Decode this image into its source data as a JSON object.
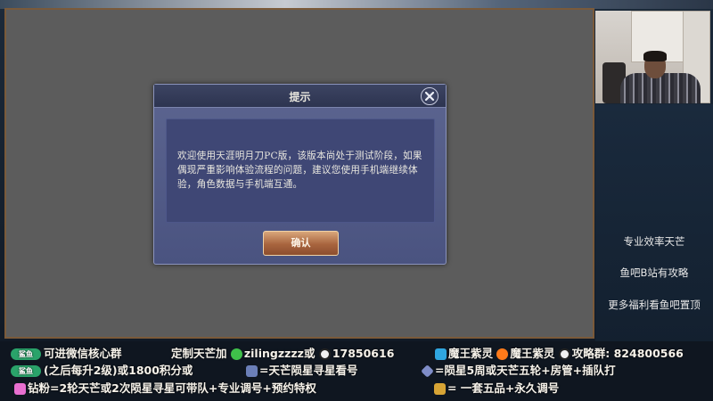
{
  "modal": {
    "title": "提示",
    "message": "欢迎使用天涯明月刀PC版，该版本尚处于测试阶段，如果偶现严重影响体验流程的问题，建议您使用手机端继续体验，角色数据与手机端互通。",
    "confirm_label": "确认"
  },
  "right_panel": {
    "lines": [
      "专业效率天芒",
      "鱼吧B站有攻略",
      "更多福利看鱼吧置顶"
    ]
  },
  "bottom_bar": {
    "row1": {
      "badge": "鲨鱼",
      "text_a": "可进微信核心群",
      "text_b": "定制天芒加",
      "wechat_id": "zilingzzzz或",
      "qq_number": "17850616",
      "bili_name": "魔王紫灵",
      "douyu_name": "魔王紫灵",
      "group_label": "攻略群: 824800566"
    },
    "row2": {
      "badge": "鲨鱼",
      "text_a": "(之后每升2级)或1800积分或",
      "text_b": "=天芒陨星寻星看号",
      "text_c": "=陨星5周或天芒五轮+房管+插队打"
    },
    "row3": {
      "text_a": "钻粉=2轮天芒或2次陨星寻星可带队+专业调号+预约特权",
      "text_b": "= 一套五品+永久调号"
    }
  },
  "colors": {
    "modal_bg": "#4a5380",
    "confirm_button": "#a8643e",
    "game_bg": "#5c5c5c",
    "badge_green": "#2aa36a"
  },
  "icons": [
    "close-icon",
    "wechat-icon",
    "qq-icon",
    "bilibili-icon",
    "douyu-icon",
    "game-icon",
    "gem-icon",
    "gift-icon",
    "diamond-icon"
  ]
}
